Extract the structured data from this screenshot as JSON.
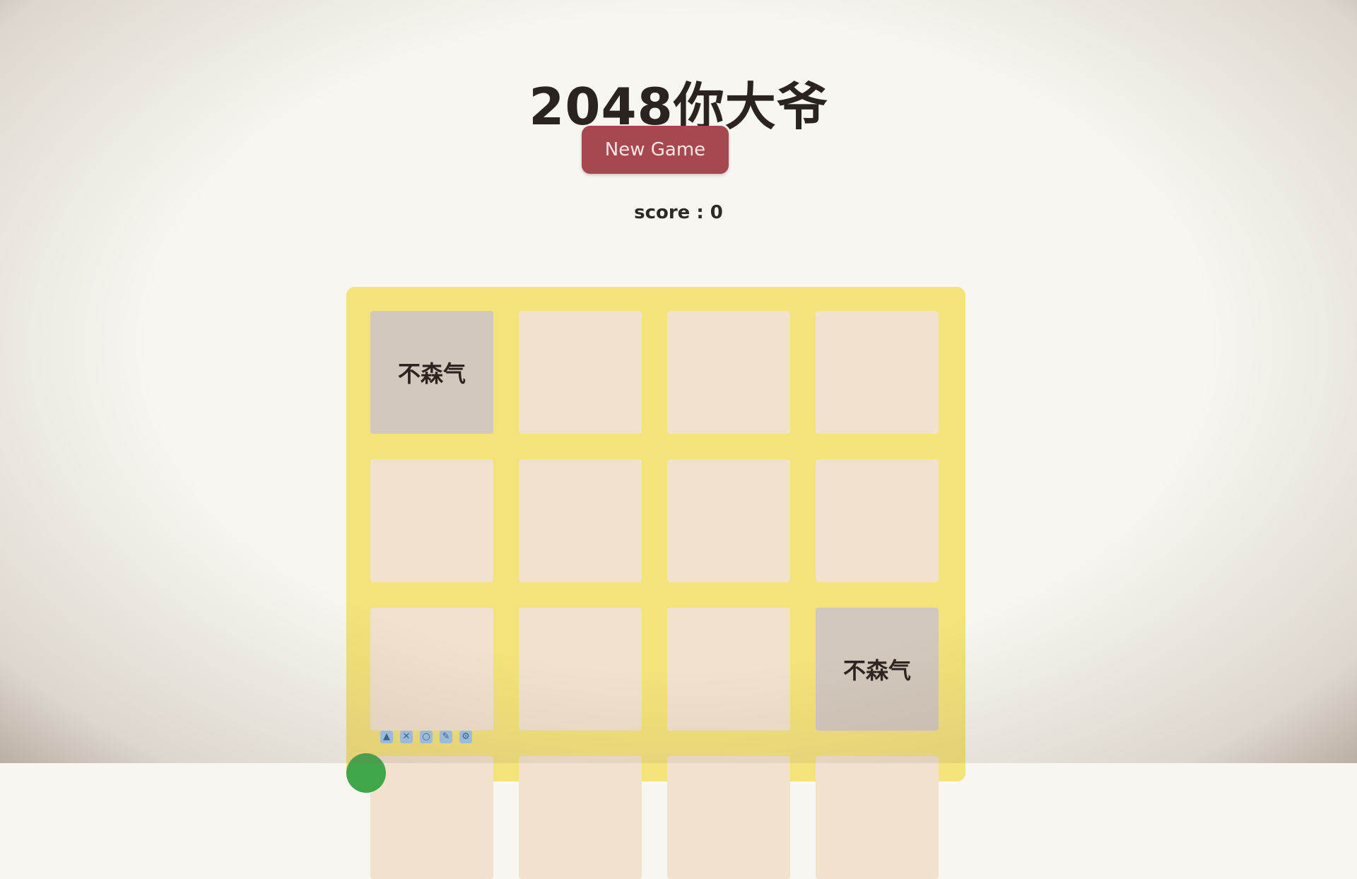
{
  "app": {
    "title": "2048你大爷"
  },
  "controls": {
    "new_game_label": "New Game"
  },
  "score": {
    "label": "score : 0",
    "value": 0
  },
  "board": {
    "rows": [
      [
        "不森气",
        "",
        "",
        ""
      ],
      [
        "",
        "",
        "",
        ""
      ],
      [
        "",
        "",
        "",
        "不森气"
      ],
      [
        "",
        "",
        "",
        ""
      ]
    ]
  },
  "colors": {
    "background": "#f8f6f1",
    "board": "#f3e37a",
    "empty_cell": "#f1e2cd",
    "filled_cell": "#d3c8bd",
    "button": "#a7474f"
  },
  "toolbar": {
    "icons": [
      "lock-icon",
      "pin-icon",
      "circle-icon",
      "pen-icon",
      "settings-icon"
    ]
  }
}
